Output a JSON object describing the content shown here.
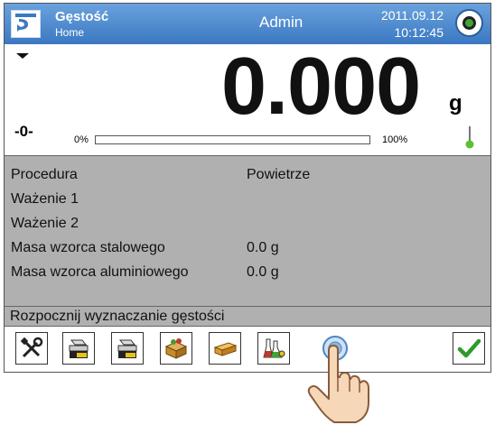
{
  "header": {
    "title": "Gęstość",
    "subtitle": "Home",
    "user": "Admin",
    "date": "2011.09.12",
    "time": "10:12:45"
  },
  "weighing": {
    "reading": "0.000",
    "unit": "g",
    "zero_indicator": "-0-",
    "bar_min_label": "0%",
    "bar_max_label": "100%",
    "bar_fill_fraction": 0
  },
  "info": {
    "rows": [
      {
        "label": "Procedura",
        "value": "Powietrze"
      },
      {
        "label": "Ważenie 1",
        "value": ""
      },
      {
        "label": "Ważenie 2",
        "value": ""
      },
      {
        "label": "Masa wzorca stalowego",
        "value": "0.0 g"
      },
      {
        "label": "Masa wzorca aluminiowego",
        "value": "0.0 g"
      }
    ]
  },
  "message": "Rozpocznij wyznaczanie gęstości",
  "toolbar": {
    "buttons": [
      {
        "icon": "tools-icon"
      },
      {
        "icon": "scale-print-icon"
      },
      {
        "icon": "scale-print-alt-icon"
      },
      {
        "icon": "box-icon"
      },
      {
        "icon": "brick-icon"
      },
      {
        "icon": "flasks-icon"
      },
      {
        "icon": "sphere-icon"
      },
      {
        "icon": "confirm-check-icon"
      }
    ]
  },
  "colors": {
    "header_bg": "#3b78c2",
    "panel_bg": "#b0b0b0",
    "accent_green": "#3fa535"
  }
}
